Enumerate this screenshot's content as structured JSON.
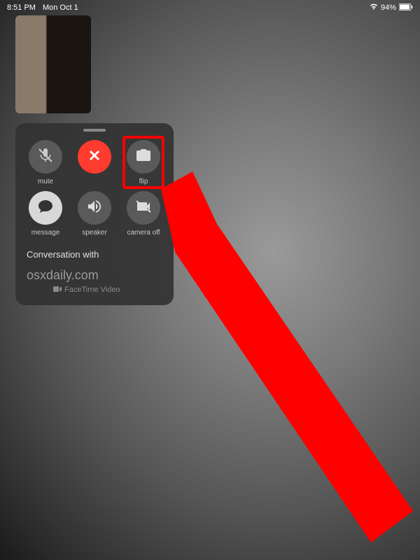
{
  "status": {
    "time": "8:51 PM",
    "date": "Mon Oct 1",
    "battery_percent": "94%"
  },
  "buttons": {
    "mute": "mute",
    "end": "",
    "flip": "flip",
    "message": "message",
    "speaker": "speaker",
    "camera_off": "camera off"
  },
  "conversation": {
    "header": "Conversation with",
    "contact": "osxdaily.com",
    "call_type": "FaceTime Video"
  },
  "colors": {
    "end_button": "#ff3b30",
    "highlight": "#ff0000",
    "annotation_arrow": "#ff0000"
  }
}
